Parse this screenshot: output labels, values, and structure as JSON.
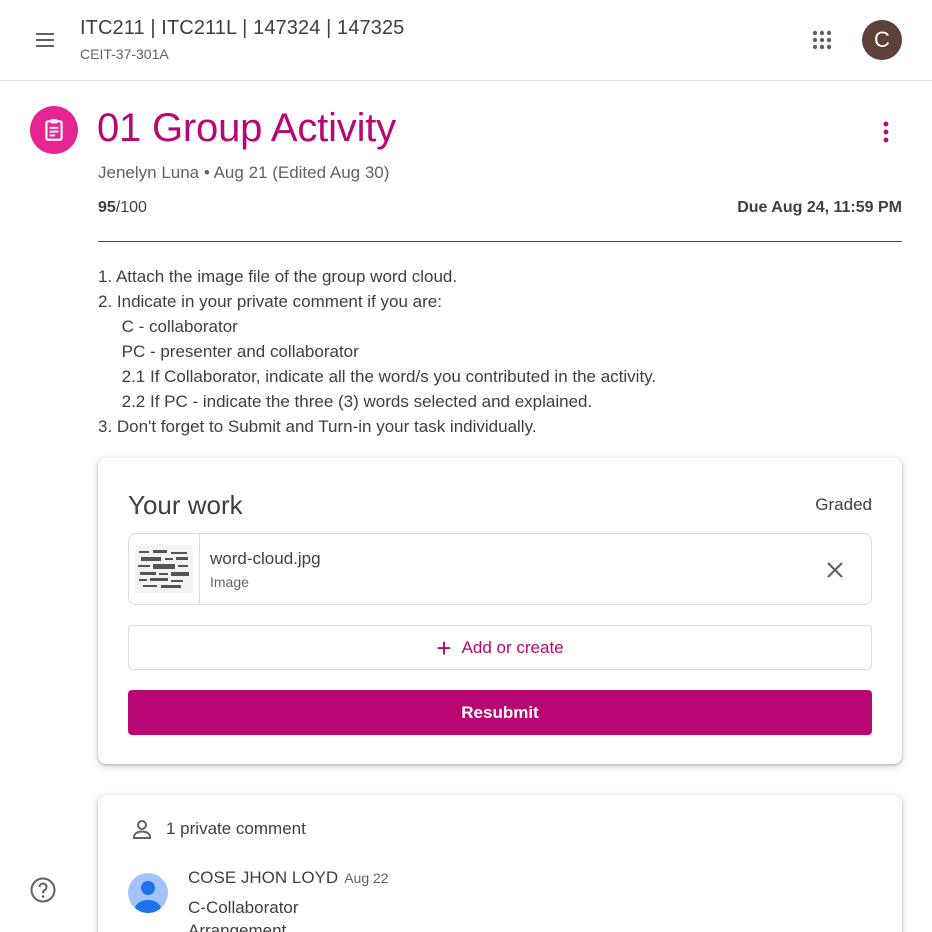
{
  "header": {
    "class_title": "ITC211 | ITC211L | 147324 | 147325",
    "class_section": "CEIT-37-301A",
    "avatar_letter": "C",
    "menu_icon": "hamburger-menu-icon",
    "apps_icon": "apps-grid-icon"
  },
  "assignment": {
    "icon": "assignment-icon",
    "title": "01 Group Activity",
    "meta": "Jenelyn Luna • Aug 21 (Edited Aug 30)",
    "points_earned": "95",
    "points_total": "/100",
    "due": "Due Aug 24, 11:59 PM",
    "accent_color": "#b80672",
    "instructions": [
      "1. Attach the image file of the group word cloud.",
      "2. Indicate in your private comment if you are:",
      "     C - collaborator",
      "     PC - presenter and collaborator",
      "     2.1 If Collaborator, indicate all the word/s you contributed in the activity.",
      "     2.2 If PC - indicate the three (3) words selected and explained.",
      "3. Don't forget to Submit and Turn-in your task individually."
    ]
  },
  "your_work": {
    "title": "Your work",
    "status": "Graded",
    "attachment": {
      "name": "word-cloud.jpg",
      "type": "Image"
    },
    "add_label": "Add or create",
    "resubmit_label": "Resubmit"
  },
  "comments": {
    "header": "1 private comment",
    "items": [
      {
        "author": "COSE JHON LOYD",
        "date": "Aug 22",
        "lines": [
          "C-Collaborator",
          "Arrangement"
        ]
      }
    ]
  }
}
